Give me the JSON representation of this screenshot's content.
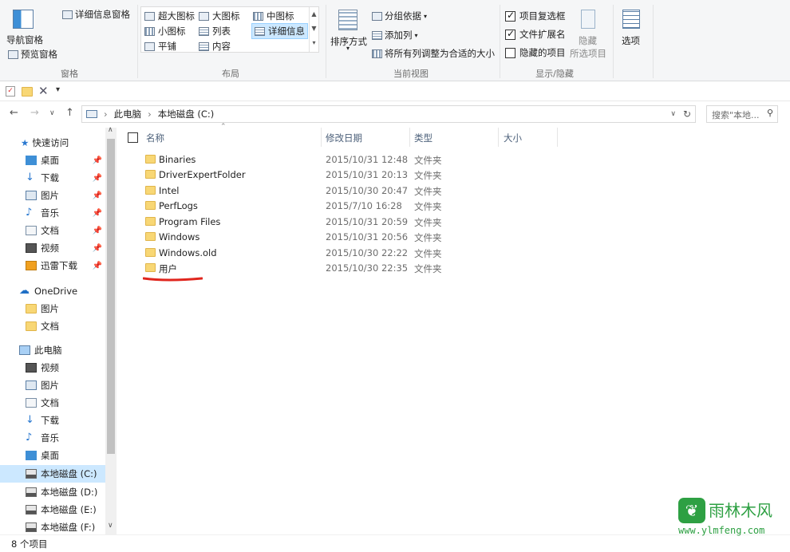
{
  "ribbon": {
    "pane_group": {
      "nav_pane": "导航窗格",
      "preview_pane": "预览窗格",
      "details_pane": "详细信息窗格",
      "label": "窗格"
    },
    "layout_group": {
      "items": [
        "超大图标",
        "大图标",
        "中图标",
        "小图标",
        "列表",
        "详细信息",
        "平铺",
        "内容"
      ],
      "label": "布局"
    },
    "current_view_group": {
      "sort_by": "排序方式",
      "group_by": "分组依据",
      "add_columns": "添加列",
      "size_all_columns": "将所有列调整为合适的大小",
      "label": "当前视图"
    },
    "show_hide_group": {
      "item_checkboxes": "项目复选框",
      "file_extensions": "文件扩展名",
      "hidden_items": "隐藏的项目",
      "hide_selected_1": "隐藏",
      "hide_selected_2": "所选项目",
      "label": "显示/隐藏"
    },
    "options": "选项"
  },
  "address": {
    "crumbs": [
      "此电脑",
      "本地磁盘 (C:)"
    ],
    "search_placeholder": "搜索\"本地..."
  },
  "sidebar": {
    "quick_access": "快速访问",
    "quick_items": [
      "桌面",
      "下载",
      "图片",
      "音乐",
      "文档",
      "视频",
      "迅雷下载"
    ],
    "onedrive": "OneDrive",
    "onedrive_items": [
      "图片",
      "文档"
    ],
    "this_pc": "此电脑",
    "pc_items": [
      "视频",
      "图片",
      "文档",
      "下载",
      "音乐",
      "桌面",
      "本地磁盘 (C:)",
      "本地磁盘 (D:)",
      "本地磁盘 (E:)",
      "本地磁盘 (F:)"
    ]
  },
  "columns": {
    "name": "名称",
    "date": "修改日期",
    "type": "类型",
    "size": "大小"
  },
  "files": [
    {
      "name": "Binaries",
      "date": "2015/10/31 12:48",
      "type": "文件夹"
    },
    {
      "name": "DriverExpertFolder",
      "date": "2015/10/31 20:13",
      "type": "文件夹"
    },
    {
      "name": "Intel",
      "date": "2015/10/30 20:47",
      "type": "文件夹"
    },
    {
      "name": "PerfLogs",
      "date": "2015/7/10 16:28",
      "type": "文件夹"
    },
    {
      "name": "Program Files",
      "date": "2015/10/31 20:59",
      "type": "文件夹"
    },
    {
      "name": "Windows",
      "date": "2015/10/31 20:56",
      "type": "文件夹"
    },
    {
      "name": "Windows.old",
      "date": "2015/10/30 22:22",
      "type": "文件夹"
    },
    {
      "name": "用户",
      "date": "2015/10/30 22:35",
      "type": "文件夹"
    }
  ],
  "status": "8 个项目",
  "watermark": {
    "brand": "雨林木风",
    "url": "www.ylmfeng.com"
  },
  "colors": {
    "selection": "#cce8ff",
    "folder": "#f8d775",
    "accent": "#3e8fd6",
    "annotation": "#e0261e",
    "brand_green": "#2ea043"
  }
}
